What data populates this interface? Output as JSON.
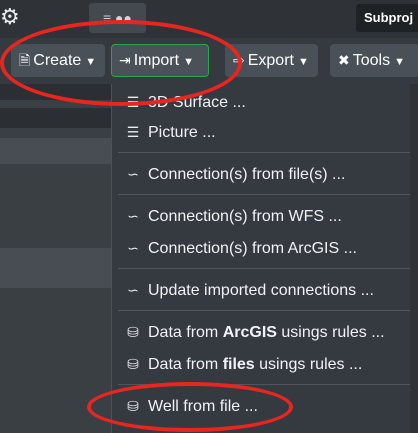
{
  "header": {
    "gear_icon": "gear-icon",
    "users_icon": "users-icon",
    "subproject_label": "Subproj"
  },
  "toolbar": {
    "create_label": "Create",
    "import_label": "Import",
    "export_label": "Export",
    "tools_label": "Tools"
  },
  "import_menu": {
    "items": [
      {
        "label": "3D Surface ...",
        "icon": "layers-icon"
      },
      {
        "label": "Picture ...",
        "icon": "layers-icon"
      },
      {
        "label": "Connection(s) from file(s) ...",
        "icon": "connection-icon"
      },
      {
        "label": "Connection(s) from WFS ...",
        "icon": "connection-icon"
      },
      {
        "label": "Connection(s) from ArcGIS ...",
        "icon": "connection-icon"
      },
      {
        "label": "Update imported connections ...",
        "icon": "connection-icon"
      },
      {
        "label_prefix": "Data from ",
        "label_bold": "ArcGIS",
        "label_suffix": " usings rules ...",
        "icon": "database-icon"
      },
      {
        "label_prefix": "Data from ",
        "label_bold": "files",
        "label_suffix": " usings rules ...",
        "icon": "database-icon"
      },
      {
        "label": "Well from file ...",
        "icon": "database-icon"
      }
    ]
  },
  "colors": {
    "annotation": "#e8261f",
    "active_border": "#28a745",
    "menu_bg": "#343a40"
  }
}
